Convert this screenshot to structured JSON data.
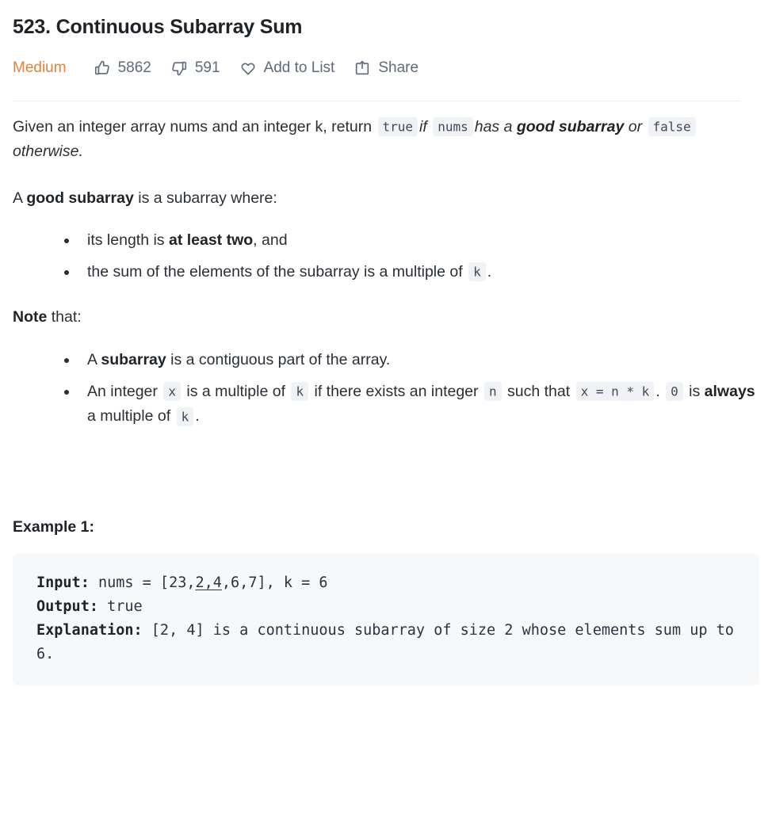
{
  "problem": {
    "title": "523. Continuous Subarray Sum",
    "difficulty": "Medium",
    "likes": "5862",
    "dislikes": "591",
    "add_to_list_label": "Add to List",
    "share_label": "Share"
  },
  "description": {
    "p1": {
      "t1": "Given an integer array nums and an integer k, return ",
      "c1": "true",
      "t2": "if",
      "c2": "nums",
      "t3": "has a ",
      "b1": "good subarray",
      "t4": " or ",
      "c3": "false",
      "t5": " otherwise."
    },
    "p2": {
      "t1": "A ",
      "b1": "good subarray",
      "t2": " is a subarray where:"
    },
    "list1": {
      "i1": {
        "t1": "its length is ",
        "b1": "at least two",
        "t2": ", and"
      },
      "i2": {
        "t1": "the sum of the elements of the subarray is a multiple of ",
        "c1": "k",
        "t2": "."
      }
    },
    "p3": {
      "b1": "Note",
      "t1": " that:"
    },
    "list2": {
      "i1": {
        "t1": "A ",
        "b1": "subarray",
        "t2": " is a contiguous part of the array."
      },
      "i2": {
        "t1": "An integer ",
        "c1": "x",
        "t2": " is a multiple of ",
        "c2": "k",
        "t3": " if there exists an integer ",
        "c3": "n",
        "t4": " such that ",
        "c4": "x = n * k",
        "t5": ". ",
        "c5": "0",
        "t6": " is ",
        "b2": "always",
        "t7": " a multiple of ",
        "c6": "k",
        "t8": "."
      }
    }
  },
  "example": {
    "heading": "Example 1:",
    "input_label": "Input:",
    "input_pre": " nums = [23,",
    "input_selected": "2,4",
    "input_post": ",6,7], k = 6",
    "output_label": "Output:",
    "output_value": " true",
    "explanation_label": "Explanation:",
    "explanation_value": " [2, 4] is a continuous subarray of size 2 whose elements sum up to 6."
  },
  "colors": {
    "difficulty_medium": "#e2813c",
    "meta_icon": "#5d6b7a",
    "code_chip_bg": "#f0f2f5",
    "codeblock_bg": "#f7f8fa",
    "body_text": "#2a2f36"
  }
}
